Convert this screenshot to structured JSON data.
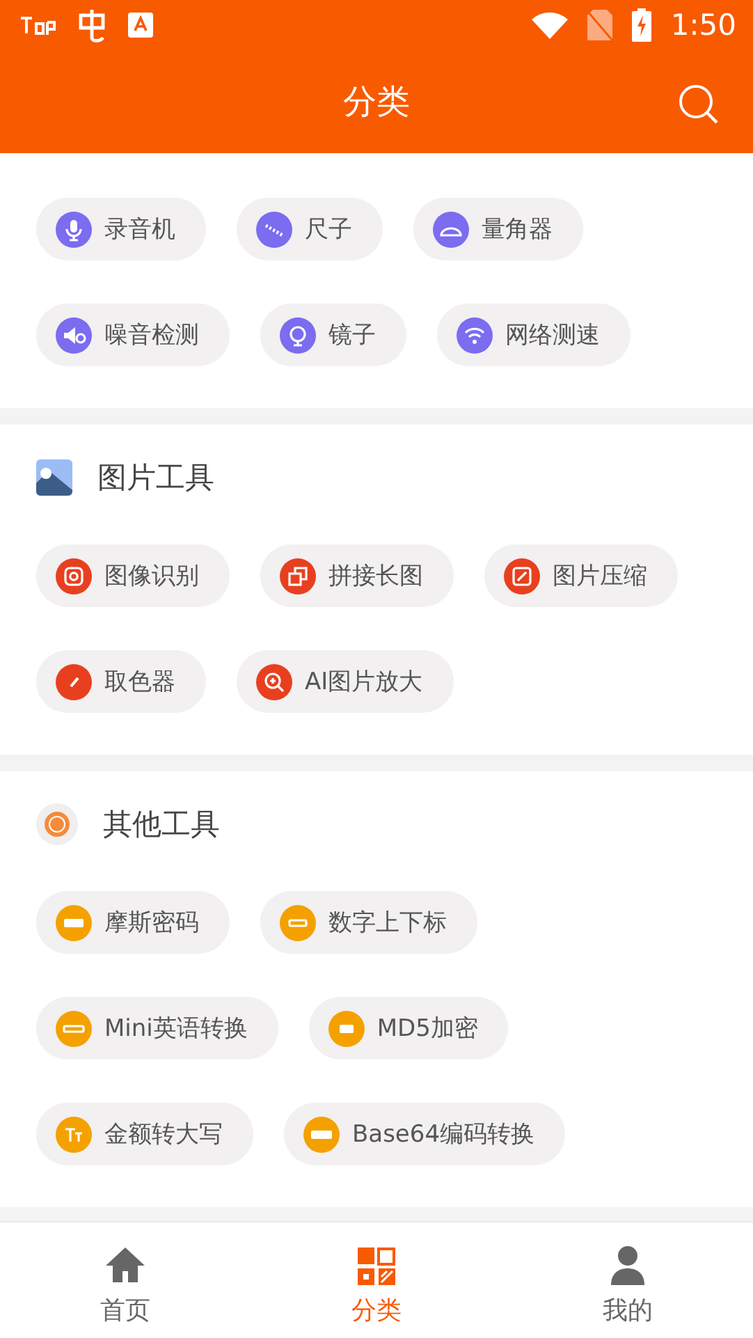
{
  "status_bar": {
    "time": "1:50"
  },
  "header": {
    "title": "分类"
  },
  "sections": [
    {
      "color": "#7b6cf0",
      "tools": [
        {
          "label": "录音机"
        },
        {
          "label": "尺子"
        },
        {
          "label": "量角器"
        },
        {
          "label": "噪音检测"
        },
        {
          "label": "镜子"
        },
        {
          "label": "网络测速"
        }
      ]
    },
    {
      "title": "图片工具",
      "color": "#e8401f",
      "tools": [
        {
          "label": "图像识别"
        },
        {
          "label": "拼接长图"
        },
        {
          "label": "图片压缩"
        },
        {
          "label": "取色器"
        },
        {
          "label": "AI图片放大"
        }
      ]
    },
    {
      "title": "其他工具",
      "color": "#f4a100",
      "tools": [
        {
          "label": "摩斯密码"
        },
        {
          "label": "数字上下标"
        },
        {
          "label": "Mini英语转换"
        },
        {
          "label": "MD5加密"
        },
        {
          "label": "金额转大写"
        },
        {
          "label": "Base64编码转换"
        }
      ]
    }
  ],
  "bottom_nav": [
    {
      "label": "首页",
      "selected": false
    },
    {
      "label": "分类",
      "selected": true
    },
    {
      "label": "我的",
      "selected": false
    }
  ]
}
